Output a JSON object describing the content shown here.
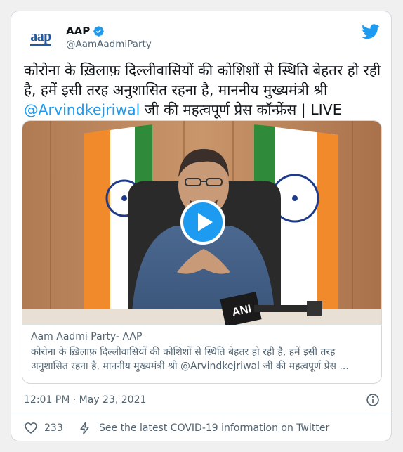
{
  "author": {
    "logo_text": "aap",
    "name": "AAP",
    "handle": "@AamAadmiParty"
  },
  "tweet": {
    "text": "कोरोना के ख़िलाफ़ दिल्लीवासियों की कोशिशों से स्थिति बेहतर हो रही है, हमें इसी तरह अनुशासित रहना है, माननीय मुख्यमंत्री श्री ",
    "mention": "@Arvindkejriwal",
    "text_after": " जी की महत्वपूर्ण प्रेस कॉन्फ्रेंस | LIVE"
  },
  "media_card": {
    "source": "Aam Aadmi Party- AAP",
    "description": "कोरोना के ख़िलाफ़ दिल्लीवासियों की कोशिशों से स्थिति बेहतर हो रही है, हमें इसी तरह अनुशासित रहना है, माननीय मुख्यमंत्री श्री @Arvindkejriwal जी की महत्वपूर्ण प्रेस ...",
    "mic_label": "ANI"
  },
  "timestamp": "12:01 PM · May 23, 2021",
  "actions": {
    "like_count": "233",
    "covid_link": "See the latest COVID-19 information on Twitter"
  },
  "colors": {
    "twitter_blue": "#1d9bf0",
    "secondary_text": "#536471",
    "border": "#cfd9de",
    "aap_blue": "#1e5aa8"
  },
  "icons": [
    "verified-badge-icon",
    "twitter-bird-icon",
    "play-icon",
    "info-icon",
    "heart-icon",
    "bolt-icon"
  ]
}
